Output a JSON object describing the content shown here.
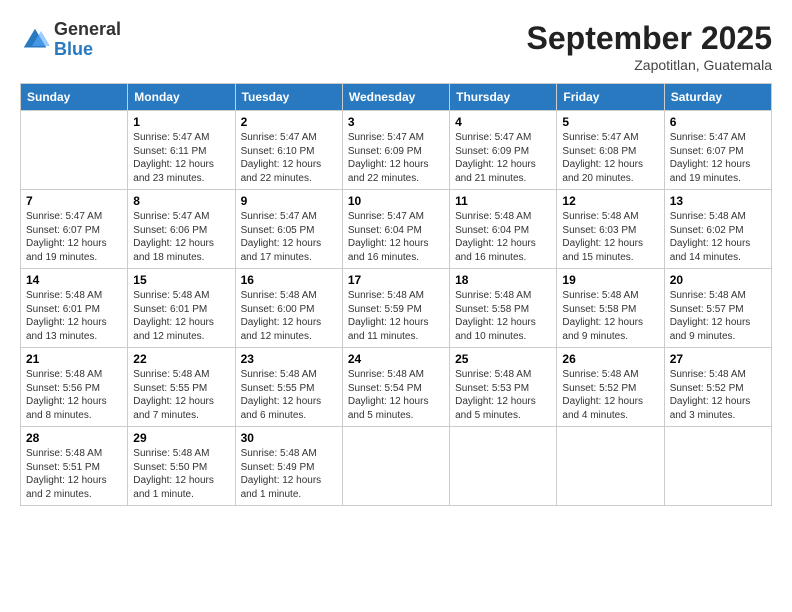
{
  "header": {
    "logo": {
      "general": "General",
      "blue": "Blue"
    },
    "title": "September 2025",
    "location": "Zapotitlan, Guatemala"
  },
  "calendar": {
    "weekdays": [
      "Sunday",
      "Monday",
      "Tuesday",
      "Wednesday",
      "Thursday",
      "Friday",
      "Saturday"
    ],
    "weeks": [
      [
        {
          "day": null
        },
        {
          "day": "1",
          "sunrise": "Sunrise: 5:47 AM",
          "sunset": "Sunset: 6:11 PM",
          "daylight": "Daylight: 12 hours and 23 minutes."
        },
        {
          "day": "2",
          "sunrise": "Sunrise: 5:47 AM",
          "sunset": "Sunset: 6:10 PM",
          "daylight": "Daylight: 12 hours and 22 minutes."
        },
        {
          "day": "3",
          "sunrise": "Sunrise: 5:47 AM",
          "sunset": "Sunset: 6:09 PM",
          "daylight": "Daylight: 12 hours and 22 minutes."
        },
        {
          "day": "4",
          "sunrise": "Sunrise: 5:47 AM",
          "sunset": "Sunset: 6:09 PM",
          "daylight": "Daylight: 12 hours and 21 minutes."
        },
        {
          "day": "5",
          "sunrise": "Sunrise: 5:47 AM",
          "sunset": "Sunset: 6:08 PM",
          "daylight": "Daylight: 12 hours and 20 minutes."
        },
        {
          "day": "6",
          "sunrise": "Sunrise: 5:47 AM",
          "sunset": "Sunset: 6:07 PM",
          "daylight": "Daylight: 12 hours and 19 minutes."
        }
      ],
      [
        {
          "day": "7",
          "sunrise": "Sunrise: 5:47 AM",
          "sunset": "Sunset: 6:07 PM",
          "daylight": "Daylight: 12 hours and 19 minutes."
        },
        {
          "day": "8",
          "sunrise": "Sunrise: 5:47 AM",
          "sunset": "Sunset: 6:06 PM",
          "daylight": "Daylight: 12 hours and 18 minutes."
        },
        {
          "day": "9",
          "sunrise": "Sunrise: 5:47 AM",
          "sunset": "Sunset: 6:05 PM",
          "daylight": "Daylight: 12 hours and 17 minutes."
        },
        {
          "day": "10",
          "sunrise": "Sunrise: 5:47 AM",
          "sunset": "Sunset: 6:04 PM",
          "daylight": "Daylight: 12 hours and 16 minutes."
        },
        {
          "day": "11",
          "sunrise": "Sunrise: 5:48 AM",
          "sunset": "Sunset: 6:04 PM",
          "daylight": "Daylight: 12 hours and 16 minutes."
        },
        {
          "day": "12",
          "sunrise": "Sunrise: 5:48 AM",
          "sunset": "Sunset: 6:03 PM",
          "daylight": "Daylight: 12 hours and 15 minutes."
        },
        {
          "day": "13",
          "sunrise": "Sunrise: 5:48 AM",
          "sunset": "Sunset: 6:02 PM",
          "daylight": "Daylight: 12 hours and 14 minutes."
        }
      ],
      [
        {
          "day": "14",
          "sunrise": "Sunrise: 5:48 AM",
          "sunset": "Sunset: 6:01 PM",
          "daylight": "Daylight: 12 hours and 13 minutes."
        },
        {
          "day": "15",
          "sunrise": "Sunrise: 5:48 AM",
          "sunset": "Sunset: 6:01 PM",
          "daylight": "Daylight: 12 hours and 12 minutes."
        },
        {
          "day": "16",
          "sunrise": "Sunrise: 5:48 AM",
          "sunset": "Sunset: 6:00 PM",
          "daylight": "Daylight: 12 hours and 12 minutes."
        },
        {
          "day": "17",
          "sunrise": "Sunrise: 5:48 AM",
          "sunset": "Sunset: 5:59 PM",
          "daylight": "Daylight: 12 hours and 11 minutes."
        },
        {
          "day": "18",
          "sunrise": "Sunrise: 5:48 AM",
          "sunset": "Sunset: 5:58 PM",
          "daylight": "Daylight: 12 hours and 10 minutes."
        },
        {
          "day": "19",
          "sunrise": "Sunrise: 5:48 AM",
          "sunset": "Sunset: 5:58 PM",
          "daylight": "Daylight: 12 hours and 9 minutes."
        },
        {
          "day": "20",
          "sunrise": "Sunrise: 5:48 AM",
          "sunset": "Sunset: 5:57 PM",
          "daylight": "Daylight: 12 hours and 9 minutes."
        }
      ],
      [
        {
          "day": "21",
          "sunrise": "Sunrise: 5:48 AM",
          "sunset": "Sunset: 5:56 PM",
          "daylight": "Daylight: 12 hours and 8 minutes."
        },
        {
          "day": "22",
          "sunrise": "Sunrise: 5:48 AM",
          "sunset": "Sunset: 5:55 PM",
          "daylight": "Daylight: 12 hours and 7 minutes."
        },
        {
          "day": "23",
          "sunrise": "Sunrise: 5:48 AM",
          "sunset": "Sunset: 5:55 PM",
          "daylight": "Daylight: 12 hours and 6 minutes."
        },
        {
          "day": "24",
          "sunrise": "Sunrise: 5:48 AM",
          "sunset": "Sunset: 5:54 PM",
          "daylight": "Daylight: 12 hours and 5 minutes."
        },
        {
          "day": "25",
          "sunrise": "Sunrise: 5:48 AM",
          "sunset": "Sunset: 5:53 PM",
          "daylight": "Daylight: 12 hours and 5 minutes."
        },
        {
          "day": "26",
          "sunrise": "Sunrise: 5:48 AM",
          "sunset": "Sunset: 5:52 PM",
          "daylight": "Daylight: 12 hours and 4 minutes."
        },
        {
          "day": "27",
          "sunrise": "Sunrise: 5:48 AM",
          "sunset": "Sunset: 5:52 PM",
          "daylight": "Daylight: 12 hours and 3 minutes."
        }
      ],
      [
        {
          "day": "28",
          "sunrise": "Sunrise: 5:48 AM",
          "sunset": "Sunset: 5:51 PM",
          "daylight": "Daylight: 12 hours and 2 minutes."
        },
        {
          "day": "29",
          "sunrise": "Sunrise: 5:48 AM",
          "sunset": "Sunset: 5:50 PM",
          "daylight": "Daylight: 12 hours and 1 minute."
        },
        {
          "day": "30",
          "sunrise": "Sunrise: 5:48 AM",
          "sunset": "Sunset: 5:49 PM",
          "daylight": "Daylight: 12 hours and 1 minute."
        },
        {
          "day": null
        },
        {
          "day": null
        },
        {
          "day": null
        },
        {
          "day": null
        }
      ]
    ]
  }
}
